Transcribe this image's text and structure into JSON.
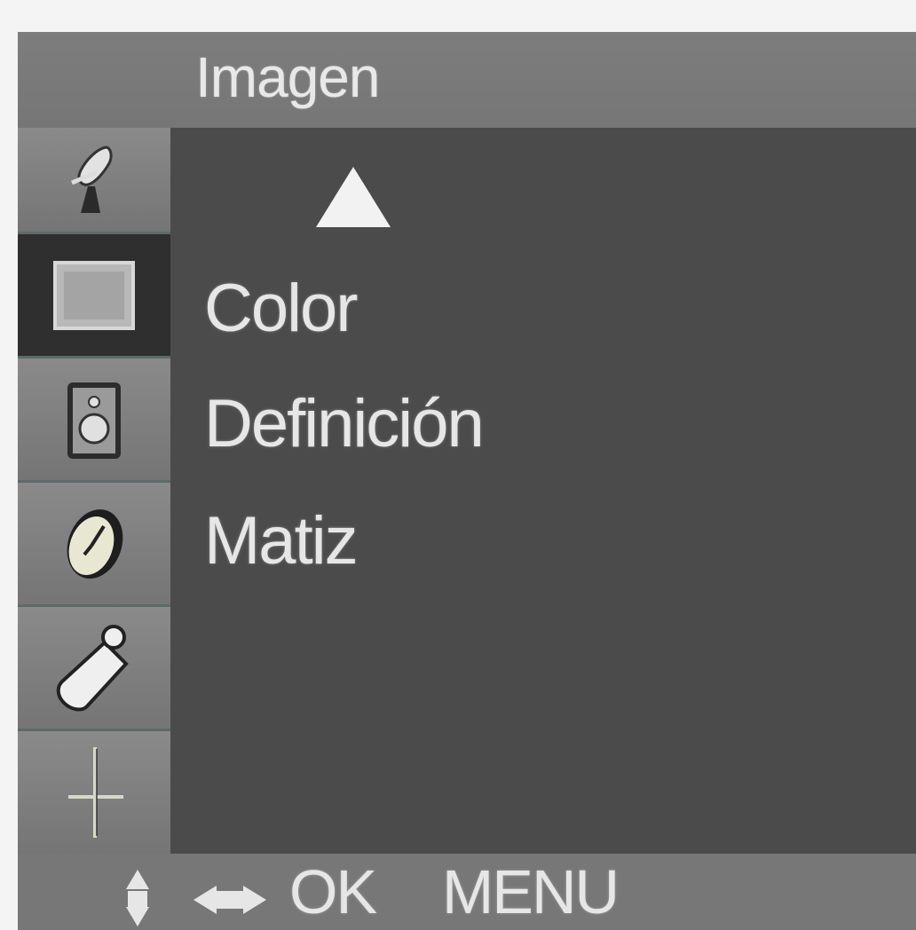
{
  "header": {
    "title": "Imagen"
  },
  "sidebar": {
    "items": [
      {
        "icon": "satellite-dish-icon",
        "selected": false
      },
      {
        "icon": "picture-screen-icon",
        "selected": true
      },
      {
        "icon": "speaker-sound-icon",
        "selected": false
      },
      {
        "icon": "clock-time-icon",
        "selected": false
      },
      {
        "icon": "tag-option-icon",
        "selected": false
      },
      {
        "icon": "crosshair-screen-icon",
        "selected": false
      }
    ]
  },
  "menu": {
    "scroll_up_icon": "up-arrow-icon",
    "items": [
      {
        "label": "Color"
      },
      {
        "label": "Definición"
      },
      {
        "label": "Matiz"
      }
    ]
  },
  "footer": {
    "updown_icon": "up-down-arrows-icon",
    "leftright_icon": "left-right-arrows-icon",
    "ok_label": "OK",
    "menu_label": "MENU"
  },
  "colors": {
    "panel_bg": "#4b4b4b",
    "header_bg": "#7b7b7b",
    "selected_bg": "#2f2f2f",
    "text": "#e6e6e6"
  }
}
